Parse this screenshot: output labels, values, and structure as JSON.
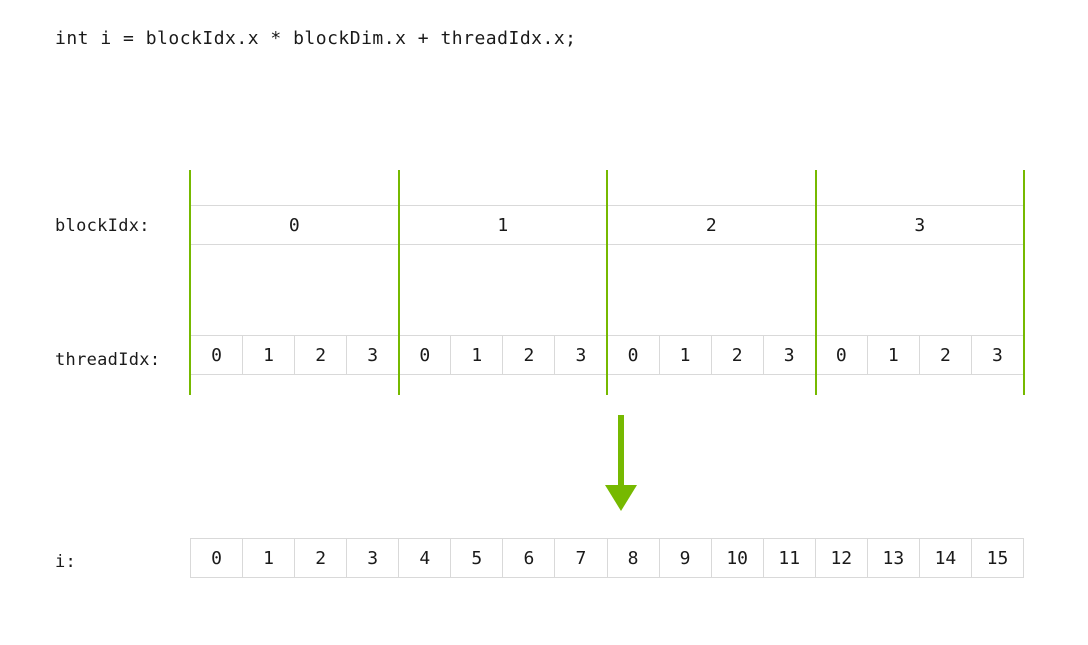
{
  "code_line": "int i = blockIdx.x * blockDim.x + threadIdx.x;",
  "labels": {
    "blockIdx": "blockIdx:",
    "threadIdx": "threadIdx:",
    "i": "i:"
  },
  "diagram": {
    "num_blocks": 4,
    "threads_per_block": 4,
    "blockIdx": [
      "0",
      "1",
      "2",
      "3"
    ],
    "threadIdx": [
      "0",
      "1",
      "2",
      "3",
      "0",
      "1",
      "2",
      "3",
      "0",
      "1",
      "2",
      "3",
      "0",
      "1",
      "2",
      "3"
    ],
    "i": [
      "0",
      "1",
      "2",
      "3",
      "4",
      "5",
      "6",
      "7",
      "8",
      "9",
      "10",
      "11",
      "12",
      "13",
      "14",
      "15"
    ]
  },
  "colors": {
    "accent": "#76b900",
    "grid": "#d9d9d9"
  }
}
